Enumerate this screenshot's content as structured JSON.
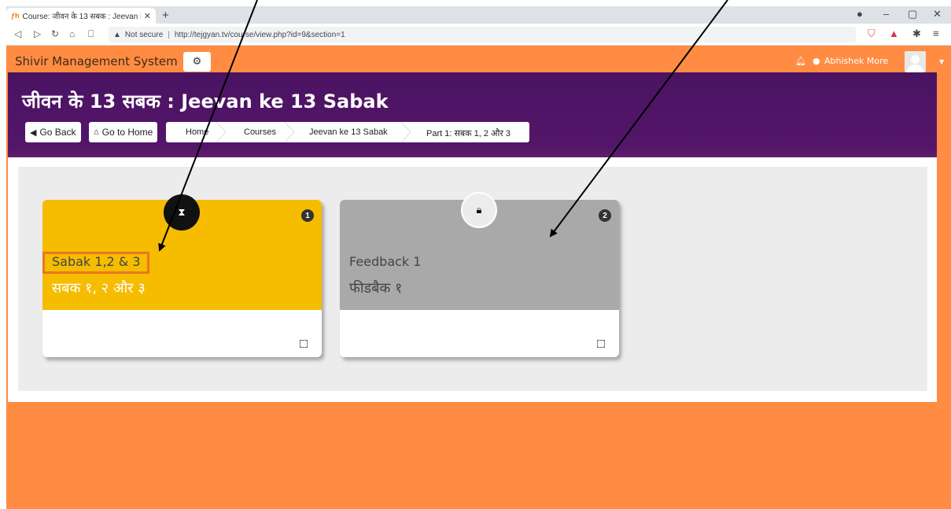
{
  "browser": {
    "tab_title": "Course: जीवन के 13 सबक : Jeevan k",
    "tab_close": "✕",
    "new_tab": "+",
    "security_label": "Not secure",
    "url": "http://tejgyan.tv/course/view.php?id=9&section=1"
  },
  "navbar": {
    "brand": "Shivir Management System",
    "user_name": "Abhishek More"
  },
  "page": {
    "title": "जीवन के 13 सबक : Jeevan ke 13 Sabak",
    "go_back": "Go Back",
    "go_home": "Go to Home",
    "breadcrumbs": [
      "Home",
      "Courses",
      "Jeevan ke 13 Sabak",
      "Part 1: सबक 1, 2 और 3"
    ]
  },
  "cards": [
    {
      "number": "1",
      "title_en": "Sabak 1,2 & 3",
      "title_hi": "सबक १, २ और ३",
      "status": "completed",
      "color": "#f5bc00"
    },
    {
      "number": "2",
      "title_en": "Feedback 1",
      "title_hi": "फीडबैक १",
      "status": "locked",
      "color": "#a9a9a9"
    }
  ],
  "colors": {
    "navbar": "#ff8c42",
    "header": "#4a1362",
    "highlight": "#e87722"
  }
}
